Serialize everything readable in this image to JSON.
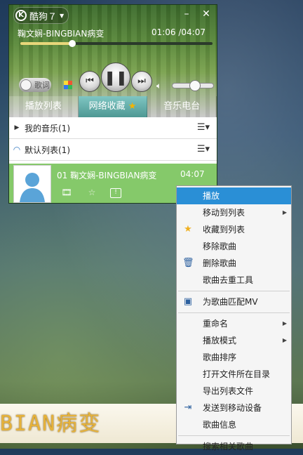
{
  "app": {
    "title": "酷狗７",
    "min_label": "–",
    "close_label": "✕"
  },
  "now_playing": {
    "title": "鞠文娴-BINGBIAN病变",
    "time": "01:06 /04:07",
    "progress": 0.27
  },
  "controls": {
    "lyrics_label": "歌词",
    "prev_glyph": "⏮",
    "play_glyph": "❚❚",
    "next_glyph": "⏭",
    "volume": 0.55
  },
  "tabs": [
    {
      "label": "播放列表"
    },
    {
      "label": "网络收藏"
    },
    {
      "label": "音乐电台"
    }
  ],
  "groups": [
    {
      "label": "我的音乐(1)"
    },
    {
      "label": "默认列表(1)"
    }
  ],
  "song_row": {
    "title": "01  鞠文娴-BINGBIAN病变",
    "duration": "04:07"
  },
  "context_menu": {
    "items": [
      {
        "label": "播放",
        "icon": ""
      },
      {
        "label": "移动到列表",
        "icon": "",
        "submenu": true
      },
      {
        "label": "收藏到列表",
        "icon": "star-icon"
      },
      {
        "label": "移除歌曲",
        "icon": ""
      },
      {
        "label": "删除歌曲",
        "icon": "trash-icon"
      },
      {
        "label": "歌曲去重工具",
        "icon": ""
      },
      {
        "label": "为歌曲匹配MV",
        "icon": "mv-icon"
      },
      {
        "label": "重命名",
        "icon": "",
        "submenu": true
      },
      {
        "label": "播放模式",
        "icon": "",
        "submenu": true
      },
      {
        "label": "歌曲排序",
        "icon": ""
      },
      {
        "label": "打开文件所在目录",
        "icon": ""
      },
      {
        "label": "导出列表文件",
        "icon": ""
      },
      {
        "label": "发送到移动设备",
        "icon": "send-device-icon"
      },
      {
        "label": "歌曲信息",
        "icon": ""
      },
      {
        "label": "搜索相关歌曲",
        "icon": ""
      }
    ]
  },
  "desktop_lyrics": {
    "text": "BIAN病变"
  },
  "colors": {
    "accent_green": "#85c96a",
    "menu_highlight": "#2a8fd6",
    "lyrics_gold": "#e6b23a"
  }
}
